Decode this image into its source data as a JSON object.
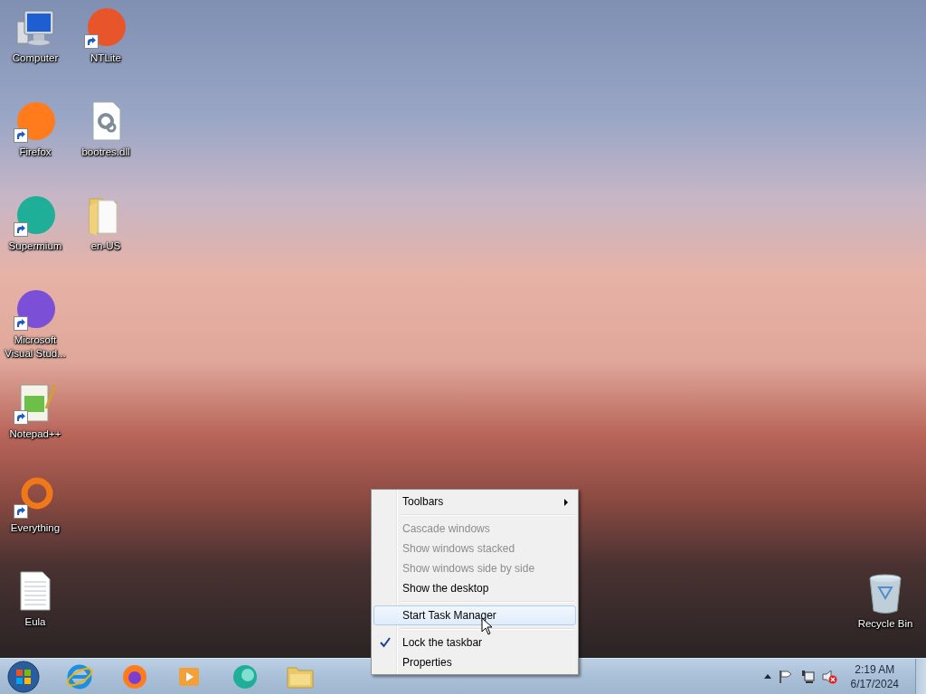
{
  "desktop_icons": {
    "columns": [
      [
        {
          "label": "Computer",
          "kind": "computer",
          "shortcut": false
        },
        {
          "label": "Firefox",
          "kind": "app",
          "color": "#ff7b1c",
          "shortcut": true
        },
        {
          "label": "Supermium",
          "kind": "app",
          "color": "#1fae98",
          "shortcut": true
        },
        {
          "label": "Microsoft Visual Stud...",
          "kind": "app",
          "color": "#7b4fd6",
          "shortcut": true
        },
        {
          "label": "Notepad++",
          "kind": "notepad",
          "shortcut": true
        },
        {
          "label": "Everything",
          "kind": "ring",
          "color": "#f07818",
          "shortcut": true
        },
        {
          "label": "Eula",
          "kind": "document",
          "shortcut": false
        }
      ],
      [
        {
          "label": "NTLite",
          "kind": "app",
          "color": "#e8552b",
          "shortcut": true
        },
        {
          "label": "bootres.dll",
          "kind": "dll",
          "shortcut": false
        },
        {
          "label": "en-US",
          "kind": "folder",
          "shortcut": false
        }
      ]
    ]
  },
  "recycle_bin": {
    "label": "Recycle Bin"
  },
  "context_menu": {
    "items": [
      {
        "kind": "item",
        "label": "Toolbars",
        "submenu": true,
        "disabled": false,
        "checked": false,
        "selected": false
      },
      {
        "kind": "separator"
      },
      {
        "kind": "item",
        "label": "Cascade windows",
        "submenu": false,
        "disabled": true,
        "checked": false,
        "selected": false
      },
      {
        "kind": "item",
        "label": "Show windows stacked",
        "submenu": false,
        "disabled": true,
        "checked": false,
        "selected": false
      },
      {
        "kind": "item",
        "label": "Show windows side by side",
        "submenu": false,
        "disabled": true,
        "checked": false,
        "selected": false
      },
      {
        "kind": "item",
        "label": "Show the desktop",
        "submenu": false,
        "disabled": false,
        "checked": false,
        "selected": false
      },
      {
        "kind": "separator"
      },
      {
        "kind": "item",
        "label": "Start Task Manager",
        "submenu": false,
        "disabled": false,
        "checked": false,
        "selected": true
      },
      {
        "kind": "separator"
      },
      {
        "kind": "item",
        "label": "Lock the taskbar",
        "submenu": false,
        "disabled": false,
        "checked": true,
        "selected": false
      },
      {
        "kind": "item",
        "label": "Properties",
        "submenu": false,
        "disabled": false,
        "checked": false,
        "selected": false
      }
    ]
  },
  "taskbar": {
    "pinned": [
      {
        "kind": "ie"
      },
      {
        "kind": "firefox"
      },
      {
        "kind": "media"
      },
      {
        "kind": "supermium"
      },
      {
        "kind": "explorer"
      }
    ],
    "clock": {
      "time": "2:19 AM",
      "date": "6/17/2024"
    }
  }
}
